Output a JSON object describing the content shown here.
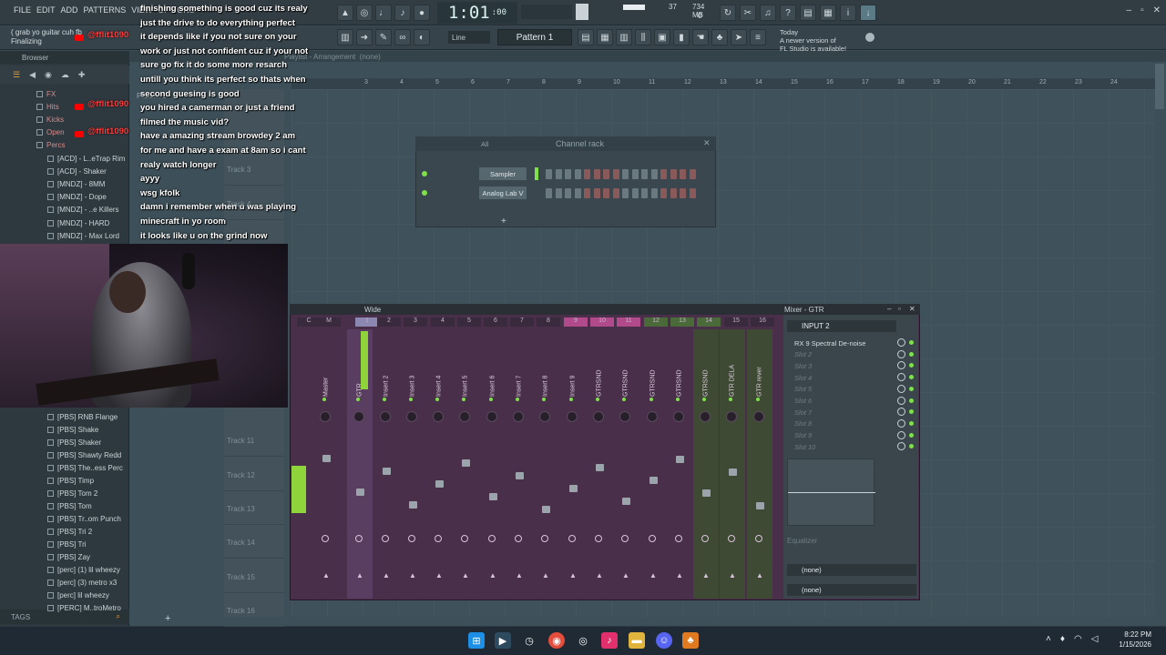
{
  "menu": [
    "FILE",
    "EDIT",
    "ADD",
    "PATTERNS",
    "VIEW",
    "OPTIONS"
  ],
  "transport": {
    "time": "1:01",
    "time_sub": ":00",
    "cpu": "37",
    "memory": "734 MB",
    "voices": "0"
  },
  "hint": {
    "line1": "( grab yo guitar cuh fb",
    "line2": "Finalizing"
  },
  "toolbar": {
    "snap": "Line",
    "pattern": "Pattern 1"
  },
  "news": {
    "line1": "Today",
    "line2": "A newer version of",
    "line3": "FL Studio is available!"
  },
  "browser": {
    "title": "Browser",
    "items_top": [
      {
        "label": "FX",
        "folder": true
      },
      {
        "label": "Hits",
        "folder": true
      },
      {
        "label": "Kicks",
        "folder": true
      },
      {
        "label": "Open",
        "folder": true
      },
      {
        "label": "Percs",
        "folder": true
      },
      {
        "label": "[ACD] - L..eTrap Rim",
        "folder": false
      },
      {
        "label": "[ACD] - Shaker",
        "folder": false
      },
      {
        "label": "[MNDZ] - 8MM",
        "folder": false
      },
      {
        "label": "[MNDZ] - Dope",
        "folder": false
      },
      {
        "label": "[MNDZ] - ..e Killers",
        "folder": false
      },
      {
        "label": "[MNDZ] - HARD",
        "folder": false
      },
      {
        "label": "[MNDZ] - Max Lord",
        "folder": false
      }
    ],
    "items_bottom": [
      "[PBS] RNB Flange",
      "[PBS] Shake",
      "[PBS] Shaker",
      "[PBS] Shawty Redd",
      "[PBS] The..ess Perc",
      "[PBS] Timp",
      "[PBS] Tom 2",
      "[PBS] Tom",
      "[PBS] Tr..om Punch",
      "[PBS] Tri 2",
      "[PBS] Tri",
      "[PBS] Zay",
      "[perc] (1) lil wheezy",
      "[perc] (3) metro x3",
      "[perc] lil wheezy",
      "[PERC] M..troMetro"
    ],
    "tags": "TAGS"
  },
  "chat": {
    "username": "@fflit1090",
    "lines": [
      "finishing something is good cuz its realy",
      "just the drive to do everything perfect",
      "it depends like if you not sure on your",
      "work or just not confident cuz if your not",
      "sure go fix it do some more resarch",
      "untill you think its perfect so thats when",
      "second guesing is good",
      "you hired a camerman or just a friend",
      "filmed the music vid?",
      "have a amazing stream browdey 2 am",
      "for me and have a exam at 8am so i cant",
      "realy watch longer",
      "ayyy",
      "wsg kfolk",
      "damn i remember when u was playing",
      "minecraft in yo room",
      "it looks like u on the grind now"
    ]
  },
  "playlist": {
    "title": "Playlist - Arrangement",
    "arrangement": "(none)",
    "pattern_label": "Pattern 1",
    "ruler": [
      "3",
      "4",
      "5",
      "6",
      "7",
      "8",
      "9",
      "10",
      "11",
      "12",
      "13",
      "14",
      "15",
      "16",
      "17",
      "18",
      "19",
      "20",
      "21",
      "22",
      "23",
      "24"
    ],
    "tracks": [
      "Track 3",
      "Track 4",
      "Track 11",
      "Track 12",
      "Track 13",
      "Track 14",
      "Track 15",
      "Track 16"
    ]
  },
  "channel_rack": {
    "filter": "All",
    "title": "Channel rack",
    "channels": [
      "Sampler",
      "Analog Lab V"
    ]
  },
  "mixer": {
    "title": "Mixer - GTR",
    "preset": "Wide",
    "numbers": [
      "C",
      "M",
      "1",
      "2",
      "3",
      "4",
      "5",
      "6",
      "7",
      "8",
      "9",
      "10",
      "11",
      "12",
      "13",
      "14",
      "15",
      "16"
    ],
    "tracks": [
      "Master",
      "GTR",
      "Insert 2",
      "Insert 3",
      "Insert 4",
      "Insert 5",
      "Insert 6",
      "Insert 7",
      "Insert 8",
      "Insert 9",
      "GTRSND",
      "GTRSND",
      "GTRSND",
      "GTRSND",
      "GTRSND",
      "GTR DELA",
      "GTR rever"
    ],
    "input": "INPUT 2",
    "slots": [
      "RX 9 Spectral De-noise",
      "Slot 2",
      "Slot 3",
      "Slot 4",
      "Slot 5",
      "Slot 6",
      "Slot 7",
      "Slot 8",
      "Slot 9",
      "Slot 10"
    ],
    "eq_label": "Equalizer",
    "out1": "(none)",
    "out2": "(none)"
  },
  "taskbar": {
    "time": "8:22 PM",
    "date": "1/15/2026"
  },
  "colors": {
    "accent_green": "#7fe04a",
    "mixer_bg": "#4a2f4b",
    "chat_name": "#ff3c3c"
  }
}
